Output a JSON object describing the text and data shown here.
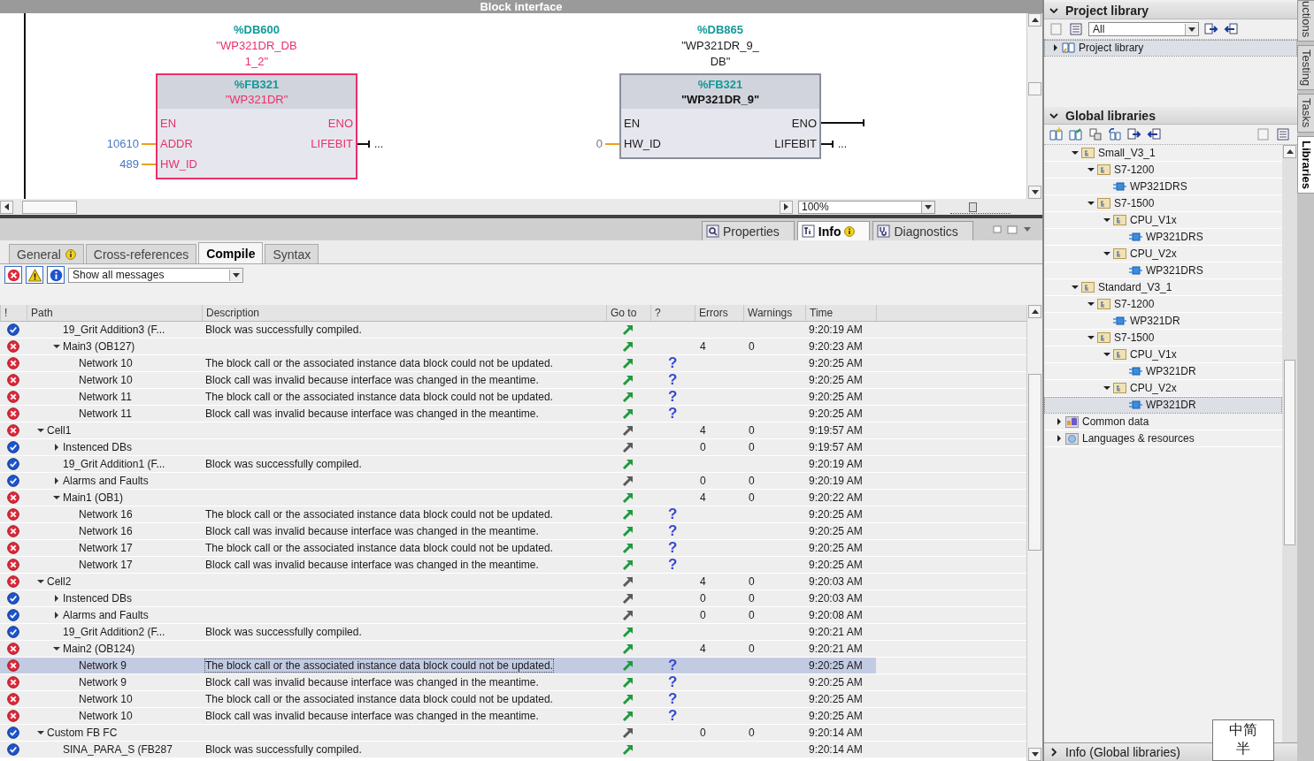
{
  "editor": {
    "title": "Block interface",
    "zoom": "100%",
    "zoom_slider": {
      "level": 0.35
    },
    "blocks": [
      {
        "error": true,
        "db": "%DB600",
        "db_name": "\"WP321DR_DB1_2\"",
        "fb": "%FB321",
        "fb_name": "\"WP321DR\"",
        "inputs": [
          {
            "pin": "EN"
          },
          {
            "pin": "ADDR",
            "value": "10610"
          },
          {
            "pin": "HW_ID",
            "value": "489"
          }
        ],
        "outputs": [
          {
            "pin": "ENO"
          },
          {
            "pin": "LIFEBIT",
            "value": "..."
          }
        ]
      },
      {
        "error": false,
        "db": "%DB865",
        "db_name": "\"WP321DR_9_DB\"",
        "fb": "%FB321",
        "fb_name": "\"WP321DR_9\"",
        "inputs": [
          {
            "pin": "EN"
          },
          {
            "pin": "HW_ID",
            "value": "0"
          }
        ],
        "outputs": [
          {
            "pin": "ENO"
          },
          {
            "pin": "LIFEBIT",
            "value": "..."
          }
        ]
      }
    ]
  },
  "inspector": {
    "tabs": [
      {
        "label": "Properties",
        "kind": "properties",
        "selected": false,
        "info_badge": false
      },
      {
        "label": "Info",
        "kind": "info",
        "selected": true,
        "info_badge": true
      },
      {
        "label": "Diagnostics",
        "kind": "diagnostics",
        "selected": false,
        "info_badge": false
      }
    ],
    "subtabs": [
      {
        "label": "General",
        "selected": false,
        "info_badge": true
      },
      {
        "label": "Cross-references",
        "selected": false,
        "info_badge": false
      },
      {
        "label": "Compile",
        "selected": true,
        "info_badge": false
      },
      {
        "label": "Syntax",
        "selected": false,
        "info_badge": false
      }
    ],
    "filters": [
      {
        "kind": "error",
        "on": true
      },
      {
        "kind": "warning",
        "on": true
      },
      {
        "kind": "info",
        "on": true
      }
    ],
    "message_filter": "Show all messages",
    "table": {
      "columns": [
        "!",
        "Path",
        "Description",
        "Go to",
        "?",
        "Errors",
        "Warnings",
        "Time"
      ],
      "rows": [
        {
          "children": [
            {
              "kind": "ok",
              "path": "19_Grit Addition3 (F...",
              "description": "Block was successfully compiled.",
              "goto_active": true,
              "time": "9:20:19 AM",
              "selected": false
            },
            {
              "kind": "error",
              "path": "Main3 (OB127)",
              "expanded": true,
              "goto_active": true,
              "errors": "4",
              "warnings": "0",
              "time": "9:20:23 AM",
              "selected": false,
              "children": [
                {
                  "kind": "error",
                  "path": "Network 10",
                  "description": "The block call or the associated instance data block could not be updated.",
                  "goto_active": true,
                  "help": "?",
                  "time": "9:20:25 AM",
                  "selected": false
                },
                {
                  "kind": "error",
                  "path": "Network 10",
                  "description": "Block call was invalid because interface was changed in the meantime.",
                  "goto_active": true,
                  "help": "?",
                  "time": "9:20:25 AM",
                  "selected": false
                },
                {
                  "kind": "error",
                  "path": "Network 11",
                  "description": "The block call or the associated instance data block could not be updated.",
                  "goto_active": true,
                  "help": "?",
                  "time": "9:20:25 AM",
                  "selected": false
                },
                {
                  "kind": "error",
                  "path": "Network 11",
                  "description": "Block call was invalid because interface was changed in the meantime.",
                  "goto_active": true,
                  "help": "?",
                  "time": "9:20:25 AM",
                  "selected": false
                }
              ]
            }
          ]
        },
        {
          "kind": "error",
          "path": "Cell1",
          "expanded": true,
          "goto_active": false,
          "errors": "4",
          "warnings": "0",
          "time": "9:19:57 AM",
          "selected": false,
          "children": [
            {
              "kind": "ok",
              "path": "Instenced DBs",
              "expanded": false,
              "goto_active": false,
              "errors": "0",
              "warnings": "0",
              "time": "9:19:57 AM",
              "selected": false
            },
            {
              "kind": "ok",
              "path": "19_Grit Addition1 (F...",
              "description": "Block was successfully compiled.",
              "goto_active": true,
              "time": "9:20:19 AM",
              "selected": false
            },
            {
              "kind": "ok",
              "path": "Alarms and Faults",
              "expanded": false,
              "goto_active": false,
              "errors": "0",
              "warnings": "0",
              "time": "9:20:19 AM",
              "selected": false
            },
            {
              "kind": "error",
              "path": "Main1 (OB1)",
              "expanded": true,
              "goto_active": true,
              "errors": "4",
              "warnings": "0",
              "time": "9:20:22 AM",
              "selected": false,
              "children": [
                {
                  "kind": "error",
                  "path": "Network 16",
                  "description": "The block call or the associated instance data block could not be updated.",
                  "goto_active": true,
                  "help": "?",
                  "time": "9:20:25 AM",
                  "selected": false
                },
                {
                  "kind": "error",
                  "path": "Network 16",
                  "description": "Block call was invalid because interface was changed in the meantime.",
                  "goto_active": true,
                  "help": "?",
                  "time": "9:20:25 AM",
                  "selected": false
                },
                {
                  "kind": "error",
                  "path": "Network 17",
                  "description": "The block call or the associated instance data block could not be updated.",
                  "goto_active": true,
                  "help": "?",
                  "time": "9:20:25 AM",
                  "selected": false
                },
                {
                  "kind": "error",
                  "path": "Network 17",
                  "description": "Block call was invalid because interface was changed in the meantime.",
                  "goto_active": true,
                  "help": "?",
                  "time": "9:20:25 AM",
                  "selected": false
                }
              ]
            }
          ]
        },
        {
          "kind": "error",
          "path": "Cell2",
          "expanded": true,
          "goto_active": false,
          "errors": "4",
          "warnings": "0",
          "time": "9:20:03 AM",
          "selected": false,
          "children": [
            {
              "kind": "ok",
              "path": "Instenced DBs",
              "expanded": false,
              "goto_active": false,
              "errors": "0",
              "warnings": "0",
              "time": "9:20:03 AM",
              "selected": false
            },
            {
              "kind": "ok",
              "path": "Alarms and Faults",
              "expanded": false,
              "goto_active": false,
              "errors": "0",
              "warnings": "0",
              "time": "9:20:08 AM",
              "selected": false
            },
            {
              "kind": "ok",
              "path": "19_Grit Addition2 (F...",
              "description": "Block was successfully compiled.",
              "goto_active": true,
              "time": "9:20:21 AM",
              "selected": false
            },
            {
              "kind": "error",
              "path": "Main2 (OB124)",
              "expanded": true,
              "goto_active": true,
              "errors": "4",
              "warnings": "0",
              "time": "9:20:21 AM",
              "selected": false,
              "children": [
                {
                  "kind": "error",
                  "path": "Network 9",
                  "description": "The block call or the associated instance data block could not be updated.",
                  "goto_active": true,
                  "help": "?",
                  "time": "9:20:25 AM",
                  "selected": true
                },
                {
                  "kind": "error",
                  "path": "Network 9",
                  "description": "Block call was invalid because interface was changed in the meantime.",
                  "goto_active": true,
                  "help": "?",
                  "time": "9:20:25 AM",
                  "selected": false
                },
                {
                  "kind": "error",
                  "path": "Network 10",
                  "description": "The block call or the associated instance data block could not be updated.",
                  "goto_active": true,
                  "help": "?",
                  "time": "9:20:25 AM",
                  "selected": false
                },
                {
                  "kind": "error",
                  "path": "Network 10",
                  "description": "Block call was invalid because interface was changed in the meantime.",
                  "goto_active": true,
                  "help": "?",
                  "time": "9:20:25 AM",
                  "selected": false
                }
              ]
            }
          ]
        },
        {
          "kind": "ok",
          "path": "Custom FB FC",
          "expanded": true,
          "goto_active": false,
          "errors": "0",
          "warnings": "0",
          "time": "9:20:14 AM",
          "selected": false,
          "children": [
            {
              "kind": "ok",
              "path": "SINA_PARA_S (FB287",
              "description": "Block was successfully compiled.",
              "goto_active": true,
              "time": "9:20:14 AM",
              "selected": false
            }
          ]
        }
      ]
    }
  },
  "project_library": {
    "title": "Project library",
    "expanded": true,
    "filter": "All",
    "tree": [
      {
        "label": "Project library",
        "expanded": false,
        "selected": true
      }
    ]
  },
  "global_libraries": {
    "title": "Global libraries",
    "expanded": true,
    "tree": [
      {
        "children": [
          {
            "label": "Small_V3_1",
            "kind": "folder",
            "expanded": true,
            "selected": false,
            "children": [
              {
                "label": "S7-1200",
                "kind": "folder",
                "expanded": true,
                "selected": false,
                "children": [
                  {
                    "label": "WP321DRS",
                    "kind": "block",
                    "selected": false
                  }
                ]
              },
              {
                "label": "S7-1500",
                "kind": "folder",
                "expanded": true,
                "selected": false,
                "children": [
                  {
                    "label": "CPU_V1x",
                    "kind": "folder",
                    "expanded": true,
                    "selected": false,
                    "children": [
                      {
                        "label": "WP321DRS",
                        "kind": "block",
                        "selected": false
                      }
                    ]
                  },
                  {
                    "label": "CPU_V2x",
                    "kind": "folder",
                    "expanded": true,
                    "selected": false,
                    "children": [
                      {
                        "label": "WP321DRS",
                        "kind": "block",
                        "selected": false
                      }
                    ]
                  }
                ]
              }
            ]
          },
          {
            "label": "Standard_V3_1",
            "kind": "folder",
            "expanded": true,
            "selected": false,
            "children": [
              {
                "label": "S7-1200",
                "kind": "folder",
                "expanded": true,
                "selected": false,
                "children": [
                  {
                    "label": "WP321DR",
                    "kind": "block",
                    "selected": false
                  }
                ]
              },
              {
                "label": "S7-1500",
                "kind": "folder",
                "expanded": true,
                "selected": false,
                "children": [
                  {
                    "label": "CPU_V1x",
                    "kind": "folder",
                    "expanded": true,
                    "selected": false,
                    "children": [
                      {
                        "label": "WP321DR",
                        "kind": "block",
                        "selected": false
                      }
                    ]
                  },
                  {
                    "label": "CPU_V2x",
                    "kind": "folder",
                    "expanded": true,
                    "selected": false,
                    "children": [
                      {
                        "label": "WP321DR",
                        "kind": "block",
                        "selected": true
                      }
                    ]
                  }
                ]
              }
            ]
          }
        ]
      },
      {
        "label": "Common data",
        "kind": "common",
        "expanded": false,
        "selected": false
      },
      {
        "label": "Languages & resources",
        "kind": "languages",
        "expanded": false,
        "selected": false
      }
    ]
  },
  "info_panel": {
    "title": "Info (Global libraries)",
    "expanded": false
  },
  "side_tabs": [
    {
      "label": "uctions",
      "selected": false
    },
    {
      "label": "Testing",
      "selected": false
    },
    {
      "label": "Tasks",
      "selected": false
    },
    {
      "label": "Libraries",
      "selected": true
    }
  ],
  "ime": {
    "line1": "中简",
    "line2": "半"
  }
}
